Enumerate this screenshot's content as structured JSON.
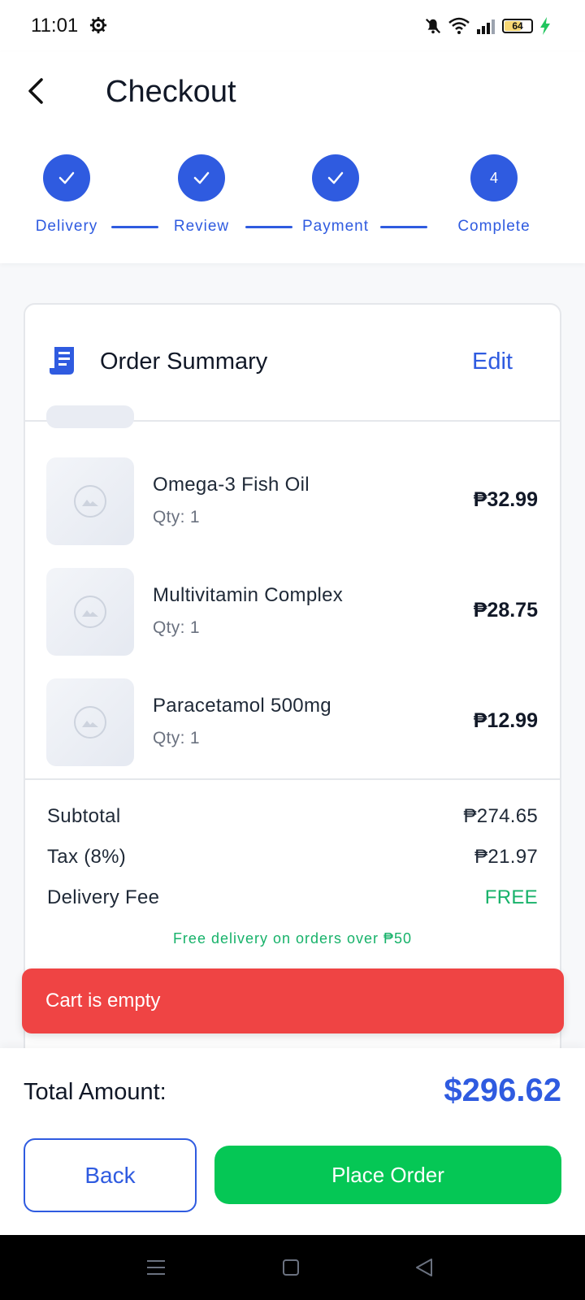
{
  "status_bar": {
    "time": "11:01",
    "battery": "64",
    "battery_level": 0.64
  },
  "header": {
    "title": "Checkout"
  },
  "stepper": {
    "steps": [
      {
        "label": "Delivery",
        "state": "complete",
        "mark": ""
      },
      {
        "label": "Review",
        "state": "complete",
        "mark": ""
      },
      {
        "label": "Payment",
        "state": "complete",
        "mark": ""
      },
      {
        "label": "Complete",
        "state": "current",
        "mark": "4"
      }
    ]
  },
  "order_summary": {
    "title": "Order Summary",
    "edit_label": "Edit",
    "items": [
      {
        "name": "Omega-3 Fish Oil",
        "qty": "Qty: 1",
        "price": "₱32.99"
      },
      {
        "name": "Multivitamin Complex",
        "qty": "Qty: 1",
        "price": "₱28.75"
      },
      {
        "name": "Paracetamol 500mg",
        "qty": "Qty: 1",
        "price": "₱12.99"
      }
    ],
    "subtotal": {
      "label": "Subtotal",
      "value": "₱274.65"
    },
    "tax": {
      "label": "Tax (8%)",
      "value": "₱21.97"
    },
    "delivery": {
      "label": "Delivery Fee",
      "value": "FREE"
    },
    "free_note": "Free delivery on orders over ₱50"
  },
  "toast": {
    "message": "Cart is empty"
  },
  "footer": {
    "total_label": "Total Amount:",
    "total_value": "$296.62",
    "back_label": "Back",
    "place_label": "Place Order"
  },
  "colors": {
    "primary": "#2f5be0",
    "success": "#05c755",
    "danger": "#ef4444",
    "free": "#17b26a"
  },
  "icons": [
    "gear-icon",
    "mute-icon",
    "wifi-icon",
    "signal-icon",
    "battery-icon",
    "charging-icon",
    "back-arrow-icon",
    "check-icon",
    "receipt-icon",
    "image-placeholder-icon",
    "menu-icon",
    "home-icon",
    "back-triangle-icon"
  ]
}
